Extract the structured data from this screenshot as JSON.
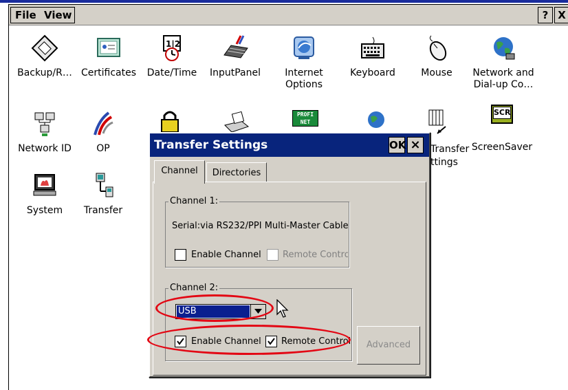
{
  "menubar": {
    "file_label": "File",
    "view_label": "View",
    "help_label": "?",
    "close_label": "X"
  },
  "desktop": {
    "icons": [
      {
        "label": "Backup/R…",
        "icon": "backup-icon"
      },
      {
        "label": "Certificates",
        "icon": "certificates-icon"
      },
      {
        "label": "Date/Time",
        "icon": "datetime-icon"
      },
      {
        "label": "InputPanel",
        "icon": "inputpanel-icon"
      },
      {
        "label": "Internet Options",
        "icon": "internet-options-icon"
      },
      {
        "label": "Keyboard",
        "icon": "keyboard-icon"
      },
      {
        "label": "Mouse",
        "icon": "mouse-icon"
      },
      {
        "label": "Network and Dial-up Co…",
        "icon": "network-dialup-icon"
      },
      {
        "label": "Network ID",
        "icon": "network-id-icon"
      },
      {
        "label": "OP",
        "icon": "op-icon"
      },
      {
        "label": "ScreenSaver",
        "icon": "screensaver-icon"
      },
      {
        "label": "System",
        "icon": "system-icon"
      },
      {
        "label": "Transfer",
        "icon": "transfer-icon"
      }
    ],
    "partial_label_line1": "Transfer",
    "partial_label_line2": "ttings",
    "screensaver_badge": "SCR",
    "profinet_badge_1": "PROFI",
    "profinet_badge_2": "NET"
  },
  "dialog": {
    "title": "Transfer Settings",
    "ok_label": "OK",
    "close_label": "×",
    "tabs": [
      {
        "label": "Channel",
        "selected": true
      },
      {
        "label": "Directories",
        "selected": false
      }
    ],
    "channel1": {
      "group_label": "Channel 1:",
      "description": "Serial:via RS232/PPI Multi-Master Cable",
      "enable_label": "Enable Channel",
      "enable_checked": false,
      "remote_label": "Remote Control",
      "remote_checked": false,
      "remote_enabled": false
    },
    "channel2": {
      "group_label": "Channel 2:",
      "selected_option": "USB",
      "enable_label": "Enable Channel",
      "enable_checked": true,
      "remote_label": "Remote Control",
      "remote_checked": true
    },
    "advanced_label": "Advanced"
  },
  "colors": {
    "title_bar": "#08247c",
    "selection": "#0a1f8f",
    "highlight_ellipse": "#e30613",
    "dialog_face": "#d4d0c8"
  }
}
